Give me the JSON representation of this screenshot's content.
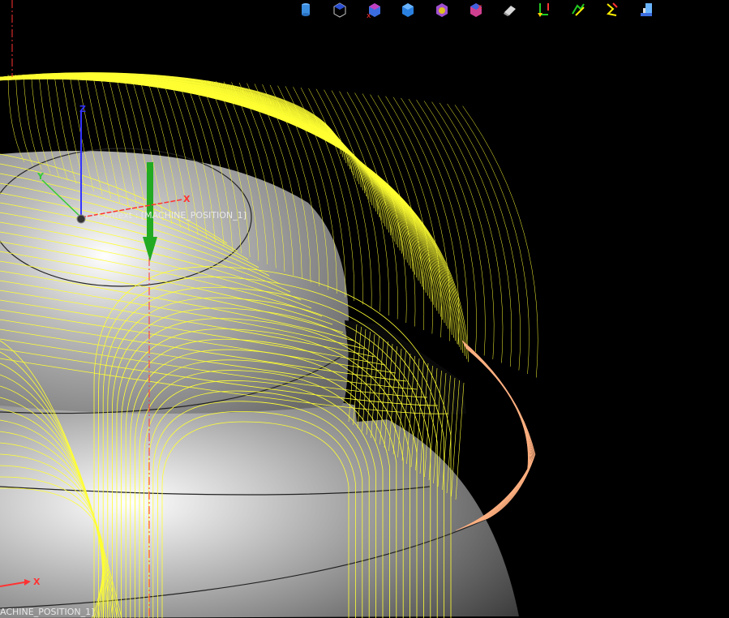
{
  "toolbar": {
    "icons": [
      "cylinder-icon",
      "wireframe-cube-icon",
      "cube-delete-icon",
      "solid-cube-icon",
      "cube-settings-icon",
      "cube-remove-icon",
      "eraser-icon",
      "toolpath-green-red-icon",
      "toolpath-zigzag-icon",
      "toolpath-yellow-red-icon",
      "machine-icon"
    ]
  },
  "viewport": {
    "context_label": "Context : [MACHINE_POSITION_1]",
    "context_label_bottom": "ACHINE_POSITION_1]",
    "axis_x": "X",
    "axis_y": "Y",
    "axis_z": "Z",
    "axis_x_bottom": "X"
  },
  "colors": {
    "background": "#000000",
    "toolpath": "#ffff33",
    "toolpath_edge": "#ffb080",
    "part": "#9a9a9a",
    "tool_arrow": "#22aa22",
    "axis_x": "#ff3333",
    "axis_y": "#33cc33",
    "axis_z": "#3333ff",
    "center_line": "#ff3333"
  }
}
